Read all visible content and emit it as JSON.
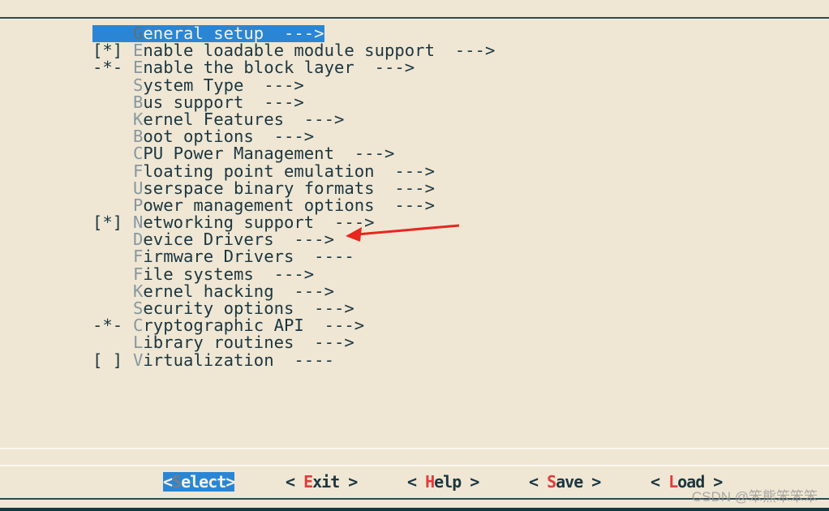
{
  "colors": {
    "background": "#efe7d4",
    "text": "#1c3640",
    "highlight": "#2a86d4",
    "hotkey": "#8797a0",
    "button_hotkey": "#e23b3b",
    "annotation_arrow": "#e8261f"
  },
  "menu": {
    "items": [
      {
        "prefix": "",
        "hotkey": "G",
        "rest": "eneral setup  --->",
        "selected": true
      },
      {
        "prefix": "[*]",
        "hotkey": "E",
        "rest": "nable loadable module support  --->"
      },
      {
        "prefix": "-*-",
        "hotkey": "E",
        "rest": "nable the block layer  --->"
      },
      {
        "prefix": "",
        "hotkey": "S",
        "rest": "ystem Type  --->"
      },
      {
        "prefix": "",
        "hotkey": "B",
        "rest": "us support  --->"
      },
      {
        "prefix": "",
        "hotkey": "K",
        "rest": "ernel Features  --->"
      },
      {
        "prefix": "",
        "hotkey": "B",
        "rest": "oot options  --->"
      },
      {
        "prefix": "",
        "hotkey": "C",
        "rest": "PU Power Management  --->"
      },
      {
        "prefix": "",
        "hotkey": "F",
        "rest": "loating point emulation  --->"
      },
      {
        "prefix": "",
        "hotkey": "U",
        "rest": "serspace binary formats  --->"
      },
      {
        "prefix": "",
        "hotkey": "P",
        "rest": "ower management options  --->"
      },
      {
        "prefix": "[*]",
        "hotkey": "N",
        "rest": "etworking support  --->"
      },
      {
        "prefix": "",
        "hotkey": "D",
        "rest": "evice Drivers  --->"
      },
      {
        "prefix": "",
        "hotkey": "F",
        "rest": "irmware Drivers  ----"
      },
      {
        "prefix": "",
        "hotkey": "F",
        "rest": "ile systems  --->"
      },
      {
        "prefix": "",
        "hotkey": "K",
        "rest": "ernel hacking  --->"
      },
      {
        "prefix": "",
        "hotkey": "S",
        "rest": "ecurity options  --->"
      },
      {
        "prefix": "-*-",
        "hotkey": "C",
        "rest": "ryptographic API  --->"
      },
      {
        "prefix": "",
        "hotkey": "L",
        "rest": "ibrary routines  --->"
      },
      {
        "prefix": "[ ]",
        "hotkey": "V",
        "rest": "irtualization  ----"
      }
    ]
  },
  "buttons": [
    {
      "pre": "<",
      "hotkey": "S",
      "rest": "elect",
      "post": ">",
      "active": true
    },
    {
      "pre": "< ",
      "hotkey": "E",
      "rest": "xit",
      "post": " >"
    },
    {
      "pre": "< ",
      "hotkey": "H",
      "rest": "elp",
      "post": " >"
    },
    {
      "pre": "< ",
      "hotkey": "S",
      "rest": "ave",
      "post": " >"
    },
    {
      "pre": "< ",
      "hotkey": "L",
      "rest": "oad",
      "post": " >"
    }
  ],
  "watermark": "CSDN @笨熊笨笨笨"
}
